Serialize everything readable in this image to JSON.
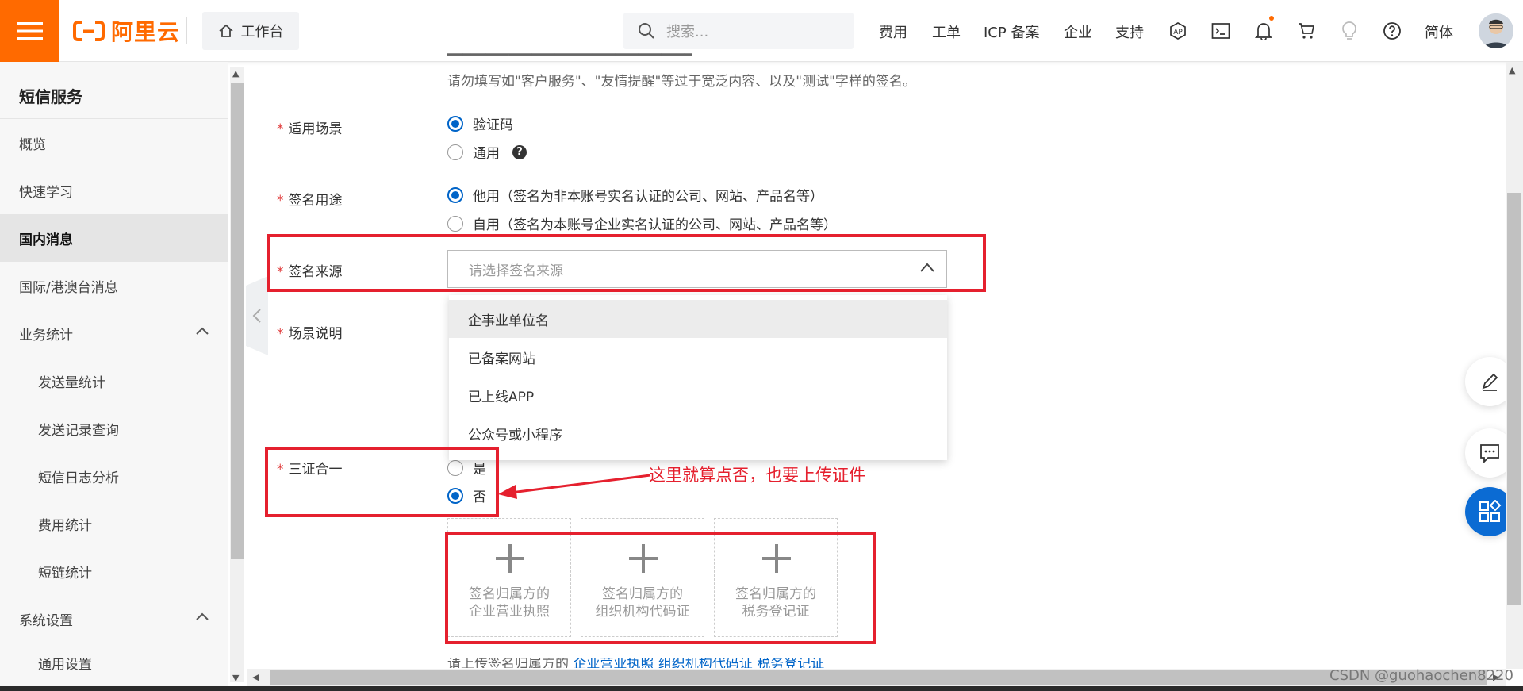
{
  "header": {
    "logo_text": "阿里云",
    "workbench_label": "工作台",
    "search_placeholder": "搜索...",
    "nav": [
      "费用",
      "工单",
      "ICP 备案",
      "企业",
      "支持"
    ],
    "lang_label": "简体",
    "accent_color": "#ff6a00"
  },
  "sidebar": {
    "title": "短信服务",
    "items": [
      {
        "label": "概览"
      },
      {
        "label": "快速学习"
      },
      {
        "label": "国内消息",
        "active": true
      },
      {
        "label": "国际/港澳台消息"
      },
      {
        "label": "业务统计",
        "expanded": true
      },
      {
        "label": "发送量统计"
      },
      {
        "label": "发送记录查询"
      },
      {
        "label": "短信日志分析"
      },
      {
        "label": "费用统计"
      },
      {
        "label": "短链统计"
      },
      {
        "label": "系统设置",
        "expanded": true
      },
      {
        "label": "通用设置"
      }
    ]
  },
  "form": {
    "top_hint": "请勿填写如\"客户服务\"、\"友情提醒\"等过于宽泛内容、以及\"测试\"字样的签名。",
    "scene": {
      "label": "适用场景",
      "options": [
        "验证码",
        "通用"
      ],
      "selected": "验证码"
    },
    "usage": {
      "label": "签名用途",
      "options": [
        "他用（签名为非本账号实名认证的公司、网站、产品名等）",
        "自用（签名为本账号企业实名认证的公司、网站、产品名等）"
      ],
      "selected": 0
    },
    "source": {
      "label": "签名来源",
      "placeholder": "请选择签名来源",
      "options": [
        "企事业单位名",
        "已备案网站",
        "已上线APP",
        "公众号或小程序"
      ],
      "highlighted": 0
    },
    "scene_desc": {
      "label": "场景说明"
    },
    "three_in_one": {
      "label": "三证合一",
      "options": [
        "是",
        "否"
      ],
      "selected": "否"
    },
    "uploads": [
      {
        "line1": "签名归属方的",
        "line2": "企业营业执照"
      },
      {
        "line1": "签名归属方的",
        "line2": "组织机构代码证"
      },
      {
        "line1": "签名归属方的",
        "line2": "税务登记证"
      }
    ],
    "upload_hint": {
      "prefix": "请上传签名归属方的",
      "links": [
        "企业营业执照",
        "组织机构代码证",
        "税务登记证"
      ]
    }
  },
  "annotation": {
    "text": "这里就算点否，也要上传证件",
    "color": "#e5202e"
  },
  "watermark": "CSDN @guohaochen8220"
}
